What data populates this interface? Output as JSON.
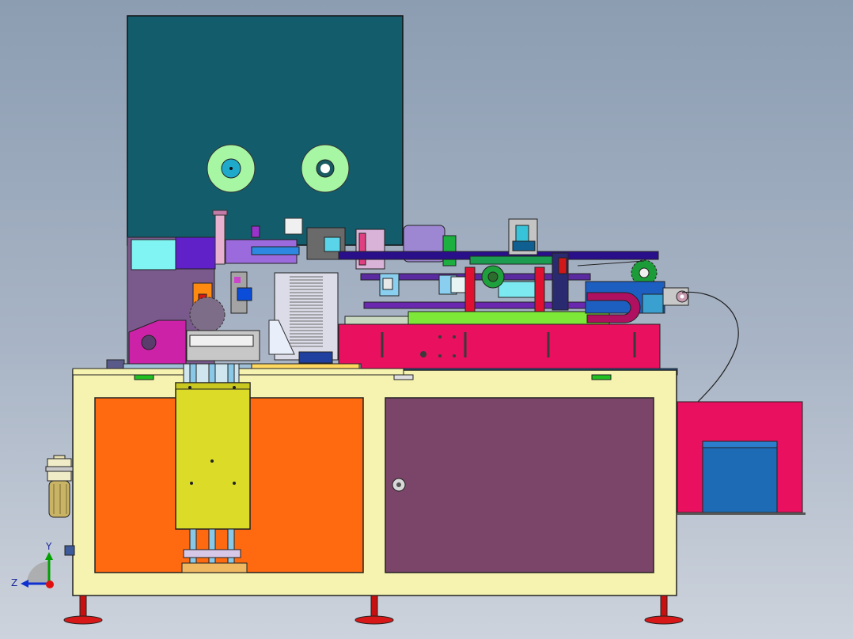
{
  "viewport": {
    "background_top": "#8c9db2",
    "background_bottom": "#cdd3dc"
  },
  "triad": {
    "y_label": "Y",
    "z_label": "Z",
    "y_color": "#00a000",
    "z_color": "#1030d0",
    "x_dot_color": "#e01010"
  },
  "colors": {
    "cabinet": "#f6f3b0",
    "left_door": "#ff6a10",
    "right_door": "#7b4569",
    "upper_panel": "#135c6c",
    "reel": "#a6f6a4",
    "pink_housing": "#e8105f",
    "blue_box": "#1d6bb5",
    "yellow_plate": "#dcdc28"
  }
}
